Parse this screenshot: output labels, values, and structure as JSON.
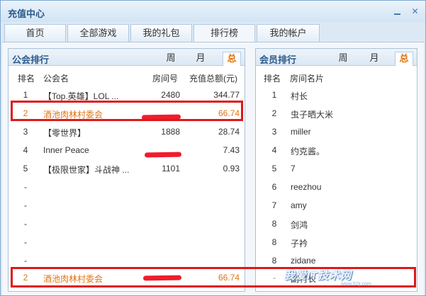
{
  "window": {
    "title": "充值中心"
  },
  "tabs": [
    "首页",
    "全部游戏",
    "我的礼包",
    "排行榜",
    "我的帐户"
  ],
  "active_tab": "排行榜",
  "left_panel": {
    "title": "公会排行",
    "period_tabs": [
      "周",
      "月",
      "总"
    ],
    "active_period": "总",
    "headers": {
      "rank": "排名",
      "name": "公会名",
      "room": "房间号",
      "total": "充值总额(元)"
    },
    "rows": [
      {
        "rank": "1",
        "name": "【Top.英雄】LOL ...",
        "room": "2480",
        "total": "344.77"
      },
      {
        "rank": "2",
        "name": "酒池肉林村委会",
        "room": "",
        "total": "66.74"
      },
      {
        "rank": "3",
        "name": "【零世界】",
        "room": "1888",
        "total": "28.74"
      },
      {
        "rank": "4",
        "name": "Inner Peace",
        "room": "",
        "total": "7.43"
      },
      {
        "rank": "5",
        "name": "【极限世家】斗战神 ...",
        "room": "1101",
        "total": "0.93"
      },
      {
        "rank": "-",
        "name": "",
        "room": "",
        "total": ""
      },
      {
        "rank": "-",
        "name": "",
        "room": "",
        "total": ""
      },
      {
        "rank": "-",
        "name": "",
        "room": "",
        "total": ""
      },
      {
        "rank": "-",
        "name": "",
        "room": "",
        "total": ""
      },
      {
        "rank": "-",
        "name": "",
        "room": "",
        "total": ""
      }
    ],
    "footer": {
      "rank": "2",
      "name": "酒池肉林村委会",
      "room": "",
      "total": "66.74"
    }
  },
  "right_panel": {
    "title": "会员排行",
    "period_tabs": [
      "周",
      "月",
      "总"
    ],
    "active_period": "总",
    "headers": {
      "rank": "排名",
      "name": "房间名片"
    },
    "rows": [
      {
        "rank": "1",
        "name": "村长"
      },
      {
        "rank": "2",
        "name": "虫子晒大米"
      },
      {
        "rank": "3",
        "name": "miller"
      },
      {
        "rank": "4",
        "name": "约克酱。"
      },
      {
        "rank": "5",
        "name": "7"
      },
      {
        "rank": "6",
        "name": "reezhou"
      },
      {
        "rank": "7",
        "name": "amy"
      },
      {
        "rank": "8",
        "name": "剑鸿"
      },
      {
        "rank": "8",
        "name": "子衿"
      },
      {
        "rank": "8",
        "name": "zidane"
      }
    ],
    "footer": {
      "rank": "-",
      "name": "副村长"
    }
  },
  "watermark": {
    "text": "我爱IT技术网",
    "sub": "www.52ij.com"
  },
  "colors": {
    "highlight": "#e07410",
    "annotation": "#e01818",
    "title": "#2b5a8a"
  }
}
